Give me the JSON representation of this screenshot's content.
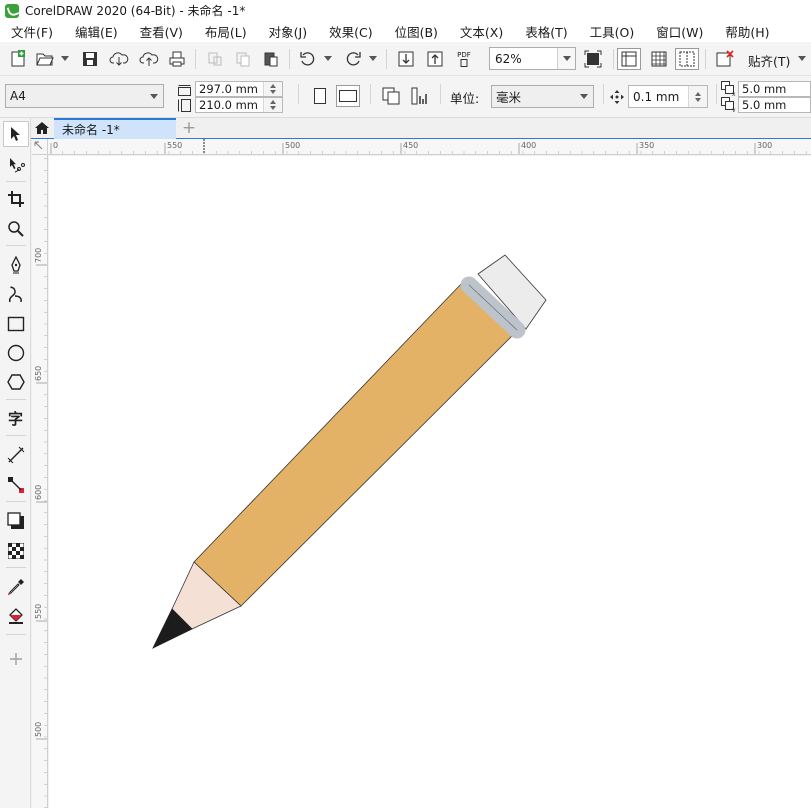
{
  "window": {
    "title": "CorelDRAW 2020 (64-Bit) - 未命名 -1*"
  },
  "menu": [
    "文件(F)",
    "编辑(E)",
    "查看(V)",
    "布局(L)",
    "对象(J)",
    "效果(C)",
    "位图(B)",
    "文本(X)",
    "表格(T)",
    "工具(O)",
    "窗口(W)",
    "帮助(H)"
  ],
  "toolbar": {
    "zoom": "62%",
    "snap_label": "贴齐(T)",
    "pdf_label": "PDF"
  },
  "property_bar": {
    "page_size": "A4",
    "width": "297.0 mm",
    "height": "210.0 mm",
    "units_label": "单位:",
    "units_value": "毫米",
    "nudge": "0.1 mm",
    "dup_x": "5.0 mm",
    "dup_y": "5.0 mm"
  },
  "tabs": {
    "document": "未命名 -1*"
  },
  "rulers": {
    "horizontal_labels": [
      "0",
      "550",
      "500",
      "450",
      "400",
      "350",
      "300"
    ],
    "vertical_labels": [
      "700",
      "650",
      "600",
      "550",
      "500"
    ]
  },
  "colors": {
    "pencil_body": "#e3b266",
    "pencil_wood": "#f4e0d5",
    "pencil_lead": "#1c1c1c",
    "ferrule": "#bdc3cb",
    "eraser": "#ececec",
    "tab_accent": "#2b79d6",
    "tab_active_bg": "#cfe3fb"
  }
}
